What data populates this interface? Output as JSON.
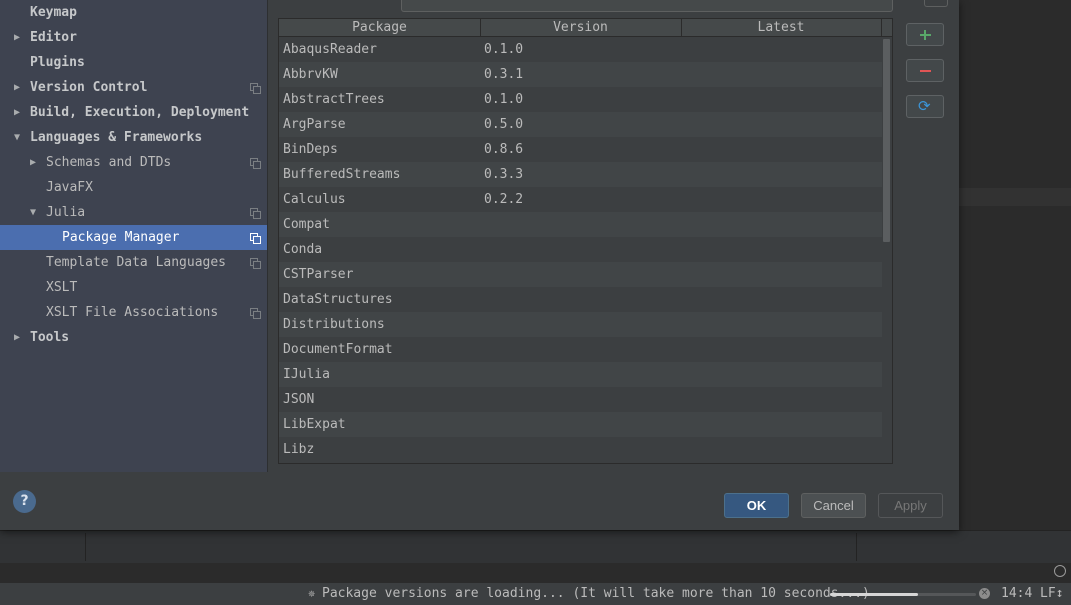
{
  "sidebar": {
    "items": [
      {
        "label": "Keymap",
        "level": 0,
        "arrow": "",
        "bold": true,
        "copy_icon": false,
        "selected": false
      },
      {
        "label": "Editor",
        "level": 0,
        "arrow": "right",
        "bold": true,
        "copy_icon": false,
        "selected": false
      },
      {
        "label": "Plugins",
        "level": 0,
        "arrow": "",
        "bold": true,
        "copy_icon": false,
        "selected": false
      },
      {
        "label": "Version Control",
        "level": 0,
        "arrow": "right",
        "bold": true,
        "copy_icon": true,
        "selected": false
      },
      {
        "label": "Build, Execution, Deployment",
        "level": 0,
        "arrow": "right",
        "bold": true,
        "copy_icon": false,
        "selected": false
      },
      {
        "label": "Languages & Frameworks",
        "level": 0,
        "arrow": "down",
        "bold": true,
        "copy_icon": false,
        "selected": false
      },
      {
        "label": "Schemas and DTDs",
        "level": 1,
        "arrow": "right",
        "bold": false,
        "copy_icon": true,
        "selected": false
      },
      {
        "label": "JavaFX",
        "level": 1,
        "arrow": "",
        "bold": false,
        "copy_icon": false,
        "selected": false
      },
      {
        "label": "Julia",
        "level": 1,
        "arrow": "down",
        "bold": false,
        "copy_icon": true,
        "selected": false
      },
      {
        "label": "Package Manager",
        "level": 2,
        "arrow": "",
        "bold": false,
        "copy_icon": true,
        "selected": true
      },
      {
        "label": "Template Data Languages",
        "level": 1,
        "arrow": "",
        "bold": false,
        "copy_icon": true,
        "selected": false
      },
      {
        "label": "XSLT",
        "level": 1,
        "arrow": "",
        "bold": false,
        "copy_icon": false,
        "selected": false
      },
      {
        "label": "XSLT File Associations",
        "level": 1,
        "arrow": "",
        "bold": false,
        "copy_icon": true,
        "selected": false
      },
      {
        "label": "Tools",
        "level": 0,
        "arrow": "right",
        "bold": true,
        "copy_icon": false,
        "selected": false
      }
    ]
  },
  "table": {
    "headers": {
      "package": "Package",
      "version": "Version",
      "latest": "Latest"
    },
    "rows": [
      {
        "package": "AbaqusReader",
        "version": "0.1.0",
        "latest": ""
      },
      {
        "package": "AbbrvKW",
        "version": "0.3.1",
        "latest": ""
      },
      {
        "package": "AbstractTrees",
        "version": "0.1.0",
        "latest": ""
      },
      {
        "package": "ArgParse",
        "version": "0.5.0",
        "latest": ""
      },
      {
        "package": "BinDeps",
        "version": "0.8.6",
        "latest": ""
      },
      {
        "package": "BufferedStreams",
        "version": "0.3.3",
        "latest": ""
      },
      {
        "package": "Calculus",
        "version": "0.2.2",
        "latest": ""
      },
      {
        "package": "Compat",
        "version": "",
        "latest": ""
      },
      {
        "package": "Conda",
        "version": "",
        "latest": ""
      },
      {
        "package": "CSTParser",
        "version": "",
        "latest": ""
      },
      {
        "package": "DataStructures",
        "version": "",
        "latest": ""
      },
      {
        "package": "Distributions",
        "version": "",
        "latest": ""
      },
      {
        "package": "DocumentFormat",
        "version": "",
        "latest": ""
      },
      {
        "package": "IJulia",
        "version": "",
        "latest": ""
      },
      {
        "package": "JSON",
        "version": "",
        "latest": ""
      },
      {
        "package": "LibExpat",
        "version": "",
        "latest": ""
      },
      {
        "package": "Libz",
        "version": "",
        "latest": ""
      }
    ]
  },
  "side_buttons": {
    "add_icon": "plus-icon",
    "remove_icon": "minus-icon",
    "refresh_icon": "refresh-icon",
    "refresh_glyph": "⟳"
  },
  "footer": {
    "help_glyph": "?",
    "ok_label": "OK",
    "cancel_label": "Cancel",
    "apply_label": "Apply"
  },
  "status_bar": {
    "message": "Package versions are loading... (It will take more than 10 seconds...)",
    "progress_fraction": 0.6,
    "cursor_position": "14:4",
    "line_separator": "LF↕",
    "spinner_glyph": "✵",
    "cancel_glyph": "×"
  },
  "colors": {
    "selection": "#4b6eaf",
    "ok_button": "#365880",
    "add_green": "#59a869",
    "remove_red": "#e05555",
    "refresh_blue": "#3b95d8"
  }
}
